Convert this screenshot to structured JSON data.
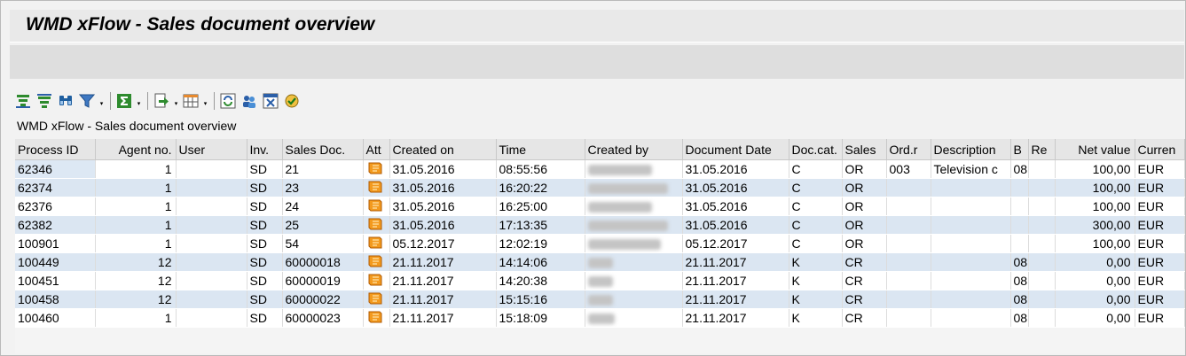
{
  "window": {
    "title": "WMD xFlow - Sales document overview"
  },
  "toolbar": {
    "buttons": [
      {
        "icon": "sort-ascending-icon"
      },
      {
        "icon": "sort-descending-icon"
      },
      {
        "icon": "find-icon"
      },
      {
        "icon": "filter-icon",
        "dropdown": true
      },
      {
        "icon": "sum-icon",
        "dropdown": true
      },
      {
        "icon": "export-icon",
        "dropdown": true
      },
      {
        "icon": "layout-icon",
        "dropdown": true
      },
      {
        "icon": "refresh-icon"
      },
      {
        "icon": "users-icon"
      },
      {
        "icon": "excel-icon"
      },
      {
        "icon": "execute-icon"
      }
    ]
  },
  "grid": {
    "title": "WMD xFlow - Sales document overview",
    "columns": [
      "Process ID",
      "Agent no.",
      "User",
      "Inv.",
      "Sales Doc.",
      "Att",
      "Created on",
      "Time",
      "Created by",
      "Document Date",
      "Doc.cat.",
      "Sales",
      "Ord.r",
      "Description",
      "B",
      "Re",
      "Net value",
      "Curren"
    ],
    "rows": [
      {
        "process_id": "62346",
        "agent_no": "1",
        "user": "",
        "inv": "SD",
        "sales_doc": "21",
        "created_on": "31.05.2016",
        "time": "08:55:56",
        "doc_date": "31.05.2016",
        "doc_cat": "C",
        "sales": "OR",
        "ord_r": "003",
        "description": "Television c",
        "b": "08",
        "re": "",
        "net_value": "100,00",
        "currency": "EUR"
      },
      {
        "process_id": "62374",
        "agent_no": "1",
        "user": "",
        "inv": "SD",
        "sales_doc": "23",
        "created_on": "31.05.2016",
        "time": "16:20:22",
        "doc_date": "31.05.2016",
        "doc_cat": "C",
        "sales": "OR",
        "ord_r": "",
        "description": "",
        "b": "",
        "re": "",
        "net_value": "100,00",
        "currency": "EUR"
      },
      {
        "process_id": "62376",
        "agent_no": "1",
        "user": "",
        "inv": "SD",
        "sales_doc": "24",
        "created_on": "31.05.2016",
        "time": "16:25:00",
        "doc_date": "31.05.2016",
        "doc_cat": "C",
        "sales": "OR",
        "ord_r": "",
        "description": "",
        "b": "",
        "re": "",
        "net_value": "100,00",
        "currency": "EUR"
      },
      {
        "process_id": "62382",
        "agent_no": "1",
        "user": "",
        "inv": "SD",
        "sales_doc": "25",
        "created_on": "31.05.2016",
        "time": "17:13:35",
        "doc_date": "31.05.2016",
        "doc_cat": "C",
        "sales": "OR",
        "ord_r": "",
        "description": "",
        "b": "",
        "re": "",
        "net_value": "300,00",
        "currency": "EUR"
      },
      {
        "process_id": "100901",
        "agent_no": "1",
        "user": "",
        "inv": "SD",
        "sales_doc": "54",
        "created_on": "05.12.2017",
        "time": "12:02:19",
        "doc_date": "05.12.2017",
        "doc_cat": "C",
        "sales": "OR",
        "ord_r": "",
        "description": "",
        "b": "",
        "re": "",
        "net_value": "100,00",
        "currency": "EUR"
      },
      {
        "process_id": "100449",
        "agent_no": "12",
        "user": "",
        "inv": "SD",
        "sales_doc": "60000018",
        "created_on": "21.11.2017",
        "time": "14:14:06",
        "doc_date": "21.11.2017",
        "doc_cat": "K",
        "sales": "CR",
        "ord_r": "",
        "description": "",
        "b": "08",
        "re": "",
        "net_value": "0,00",
        "currency": "EUR"
      },
      {
        "process_id": "100451",
        "agent_no": "12",
        "user": "",
        "inv": "SD",
        "sales_doc": "60000019",
        "created_on": "21.11.2017",
        "time": "14:20:38",
        "doc_date": "21.11.2017",
        "doc_cat": "K",
        "sales": "CR",
        "ord_r": "",
        "description": "",
        "b": "08",
        "re": "",
        "net_value": "0,00",
        "currency": "EUR"
      },
      {
        "process_id": "100458",
        "agent_no": "12",
        "user": "",
        "inv": "SD",
        "sales_doc": "60000022",
        "created_on": "21.11.2017",
        "time": "15:15:16",
        "doc_date": "21.11.2017",
        "doc_cat": "K",
        "sales": "CR",
        "ord_r": "",
        "description": "",
        "b": "08",
        "re": "",
        "net_value": "0,00",
        "currency": "EUR"
      },
      {
        "process_id": "100460",
        "agent_no": "1",
        "user": "",
        "inv": "SD",
        "sales_doc": "60000023",
        "created_on": "21.11.2017",
        "time": "15:18:09",
        "doc_date": "21.11.2017",
        "doc_cat": "K",
        "sales": "CR",
        "ord_r": "",
        "description": "",
        "b": "08",
        "re": "",
        "net_value": "0,00",
        "currency": "EUR"
      }
    ]
  },
  "colors": {
    "row_alt": "#dbe6f2",
    "header_bg": "#e6e6e6",
    "attachment_icon": "#e87a00"
  }
}
